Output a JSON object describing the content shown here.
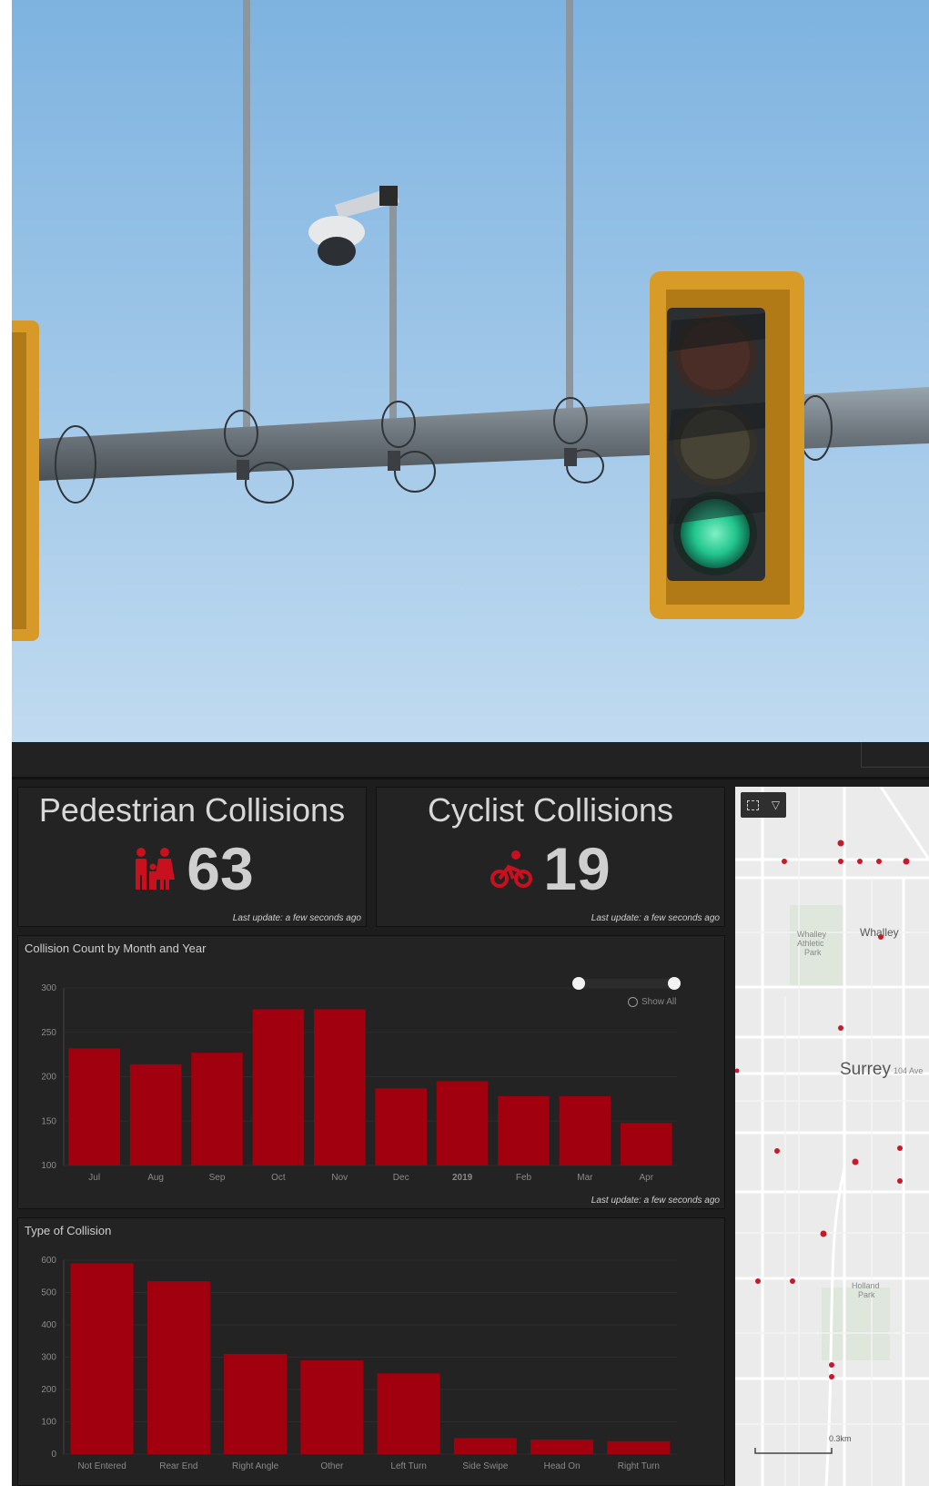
{
  "kpi": {
    "pedestrian": {
      "title": "Pedestrian Collisions",
      "value": "63",
      "icon": "pedestrian-family-icon",
      "updated": "Last update: a few seconds ago"
    },
    "cyclist": {
      "title": "Cyclist Collisions",
      "value": "19",
      "icon": "bicycle-icon",
      "updated": "Last update: a few seconds ago"
    }
  },
  "colors": {
    "bar": "#a1000e",
    "panel": "#232323",
    "bg": "#1d1d1d",
    "text": "#cfcfcf"
  },
  "month_chart": {
    "show_all": "Show All",
    "updated": "Last update: a few seconds ago"
  },
  "map": {
    "labels": {
      "whalley": "Whalley",
      "surrey": "Surrey",
      "avenue": "104 Ave",
      "park1_a": "Whalley",
      "park1_b": "Athletic",
      "park1_c": "Park",
      "park2_a": "Holland",
      "park2_b": "Park"
    },
    "scale": "0.3km"
  },
  "chart_data": [
    {
      "type": "bar",
      "title": "Collision Count by Month and Year",
      "categories": [
        "Jul",
        "Aug",
        "Sep",
        "Oct",
        "Nov",
        "Dec",
        "2019",
        "Feb",
        "Mar",
        "Apr"
      ],
      "values": [
        232,
        214,
        227,
        276,
        276,
        187,
        195,
        178,
        178,
        148
      ],
      "ylim": [
        100,
        300
      ],
      "yticks": [
        100,
        150,
        200,
        250,
        300
      ],
      "grid": true
    },
    {
      "type": "bar",
      "title": "Type of Collision",
      "categories": [
        "Not Entered",
        "Rear End",
        "Right Angle",
        "Other",
        "Left Turn",
        "Side Swipe",
        "Head On",
        "Right Turn"
      ],
      "values": [
        590,
        535,
        310,
        290,
        250,
        50,
        45,
        40
      ],
      "ylim": [
        0,
        600
      ],
      "yticks": [
        0,
        100,
        200,
        300,
        400,
        500,
        600
      ],
      "grid": true
    }
  ]
}
